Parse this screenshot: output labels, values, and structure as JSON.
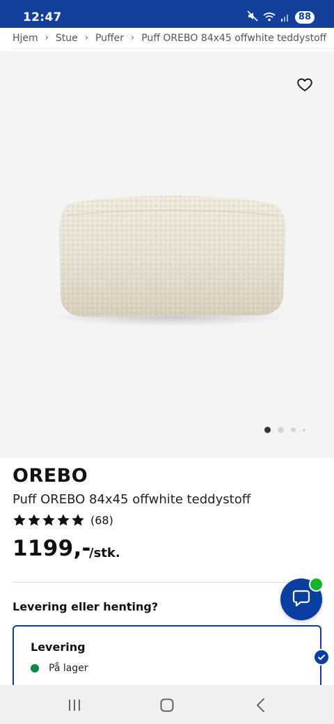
{
  "status_bar": {
    "time": "12:47",
    "battery": "88",
    "icons": [
      "mute-icon",
      "wifi-icon",
      "signal-icon"
    ]
  },
  "breadcrumb": [
    "Hjem",
    "Stue",
    "Puffer",
    "Puff OREBO 84x45 offwhite teddystoff"
  ],
  "gallery": {
    "active_dot": 1,
    "dot_count": 4
  },
  "product": {
    "brand": "OREBO",
    "name": "Puff OREBO 84x45 offwhite teddystoff",
    "rating": 5,
    "rating_count": "(68)",
    "price": "1199,-",
    "unit": "/stk."
  },
  "delivery": {
    "question": "Levering eller henting?",
    "option_title": "Levering",
    "stock_status": "På lager"
  },
  "colors": {
    "brand_blue": "#0a3ea0",
    "status_blue": "#13409a",
    "stock_green": "#0a8a3a",
    "badge_green": "#17b32a"
  }
}
